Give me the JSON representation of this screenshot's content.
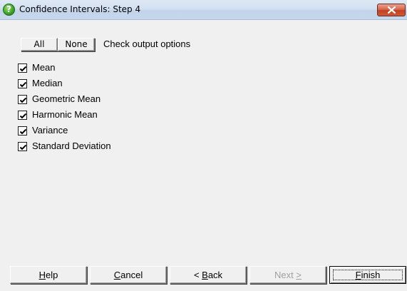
{
  "window": {
    "title": "Confidence Intervals: Step 4",
    "title_icon": "help-icon",
    "close_icon": "close-icon"
  },
  "toolbar": {
    "all_label": "All",
    "none_label": "None",
    "instruction": "Check output options"
  },
  "options": [
    {
      "label": "Mean",
      "checked": true
    },
    {
      "label": "Median",
      "checked": true
    },
    {
      "label": "Geometric Mean",
      "checked": true
    },
    {
      "label": "Harmonic Mean",
      "checked": true
    },
    {
      "label": "Variance",
      "checked": true
    },
    {
      "label": "Standard Deviation",
      "checked": true
    }
  ],
  "buttons": {
    "help": {
      "mnemonic": "H",
      "rest": "elp",
      "enabled": true
    },
    "cancel": {
      "mnemonic": "C",
      "rest": "ancel",
      "enabled": true
    },
    "back": {
      "prefix": "< ",
      "mnemonic": "B",
      "rest": "ack",
      "enabled": true
    },
    "next": {
      "prefix": "Next ",
      "mnemonic": ">",
      "rest": "",
      "enabled": false
    },
    "finish": {
      "mnemonic": "F",
      "rest": "inish",
      "enabled": true,
      "default": true
    }
  },
  "colors": {
    "window_bg": "#f0f0f0",
    "titlebar_top": "#dfe9f5",
    "close_red": "#c1401f",
    "help_icon_green": "#3fa82a",
    "disabled_text": "#a0a0a0"
  }
}
